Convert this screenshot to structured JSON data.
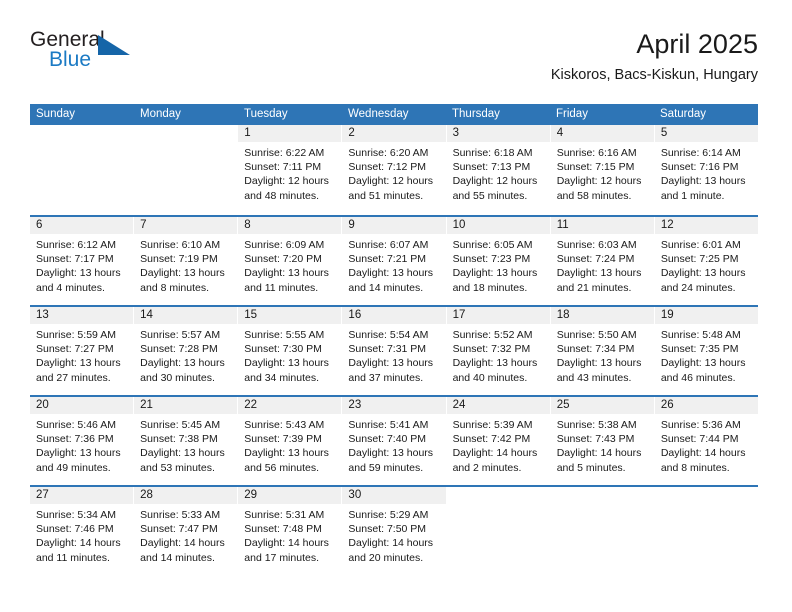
{
  "brand": {
    "logo_general": "General",
    "logo_blue": "Blue",
    "accent_color": "#1b7ac4",
    "header_color": "#2e75b6"
  },
  "header": {
    "title": "April 2025",
    "subtitle": "Kiskoros, Bacs-Kiskun, Hungary"
  },
  "weekdays": [
    "Sunday",
    "Monday",
    "Tuesday",
    "Wednesday",
    "Thursday",
    "Friday",
    "Saturday"
  ],
  "weeks": [
    [
      {
        "day": "",
        "sunrise": "",
        "sunset": "",
        "daylight1": "",
        "daylight2": ""
      },
      {
        "day": "",
        "sunrise": "",
        "sunset": "",
        "daylight1": "",
        "daylight2": ""
      },
      {
        "day": "1",
        "sunrise": "Sunrise: 6:22 AM",
        "sunset": "Sunset: 7:11 PM",
        "daylight1": "Daylight: 12 hours",
        "daylight2": "and 48 minutes."
      },
      {
        "day": "2",
        "sunrise": "Sunrise: 6:20 AM",
        "sunset": "Sunset: 7:12 PM",
        "daylight1": "Daylight: 12 hours",
        "daylight2": "and 51 minutes."
      },
      {
        "day": "3",
        "sunrise": "Sunrise: 6:18 AM",
        "sunset": "Sunset: 7:13 PM",
        "daylight1": "Daylight: 12 hours",
        "daylight2": "and 55 minutes."
      },
      {
        "day": "4",
        "sunrise": "Sunrise: 6:16 AM",
        "sunset": "Sunset: 7:15 PM",
        "daylight1": "Daylight: 12 hours",
        "daylight2": "and 58 minutes."
      },
      {
        "day": "5",
        "sunrise": "Sunrise: 6:14 AM",
        "sunset": "Sunset: 7:16 PM",
        "daylight1": "Daylight: 13 hours",
        "daylight2": "and 1 minute."
      }
    ],
    [
      {
        "day": "6",
        "sunrise": "Sunrise: 6:12 AM",
        "sunset": "Sunset: 7:17 PM",
        "daylight1": "Daylight: 13 hours",
        "daylight2": "and 4 minutes."
      },
      {
        "day": "7",
        "sunrise": "Sunrise: 6:10 AM",
        "sunset": "Sunset: 7:19 PM",
        "daylight1": "Daylight: 13 hours",
        "daylight2": "and 8 minutes."
      },
      {
        "day": "8",
        "sunrise": "Sunrise: 6:09 AM",
        "sunset": "Sunset: 7:20 PM",
        "daylight1": "Daylight: 13 hours",
        "daylight2": "and 11 minutes."
      },
      {
        "day": "9",
        "sunrise": "Sunrise: 6:07 AM",
        "sunset": "Sunset: 7:21 PM",
        "daylight1": "Daylight: 13 hours",
        "daylight2": "and 14 minutes."
      },
      {
        "day": "10",
        "sunrise": "Sunrise: 6:05 AM",
        "sunset": "Sunset: 7:23 PM",
        "daylight1": "Daylight: 13 hours",
        "daylight2": "and 18 minutes."
      },
      {
        "day": "11",
        "sunrise": "Sunrise: 6:03 AM",
        "sunset": "Sunset: 7:24 PM",
        "daylight1": "Daylight: 13 hours",
        "daylight2": "and 21 minutes."
      },
      {
        "day": "12",
        "sunrise": "Sunrise: 6:01 AM",
        "sunset": "Sunset: 7:25 PM",
        "daylight1": "Daylight: 13 hours",
        "daylight2": "and 24 minutes."
      }
    ],
    [
      {
        "day": "13",
        "sunrise": "Sunrise: 5:59 AM",
        "sunset": "Sunset: 7:27 PM",
        "daylight1": "Daylight: 13 hours",
        "daylight2": "and 27 minutes."
      },
      {
        "day": "14",
        "sunrise": "Sunrise: 5:57 AM",
        "sunset": "Sunset: 7:28 PM",
        "daylight1": "Daylight: 13 hours",
        "daylight2": "and 30 minutes."
      },
      {
        "day": "15",
        "sunrise": "Sunrise: 5:55 AM",
        "sunset": "Sunset: 7:30 PM",
        "daylight1": "Daylight: 13 hours",
        "daylight2": "and 34 minutes."
      },
      {
        "day": "16",
        "sunrise": "Sunrise: 5:54 AM",
        "sunset": "Sunset: 7:31 PM",
        "daylight1": "Daylight: 13 hours",
        "daylight2": "and 37 minutes."
      },
      {
        "day": "17",
        "sunrise": "Sunrise: 5:52 AM",
        "sunset": "Sunset: 7:32 PM",
        "daylight1": "Daylight: 13 hours",
        "daylight2": "and 40 minutes."
      },
      {
        "day": "18",
        "sunrise": "Sunrise: 5:50 AM",
        "sunset": "Sunset: 7:34 PM",
        "daylight1": "Daylight: 13 hours",
        "daylight2": "and 43 minutes."
      },
      {
        "day": "19",
        "sunrise": "Sunrise: 5:48 AM",
        "sunset": "Sunset: 7:35 PM",
        "daylight1": "Daylight: 13 hours",
        "daylight2": "and 46 minutes."
      }
    ],
    [
      {
        "day": "20",
        "sunrise": "Sunrise: 5:46 AM",
        "sunset": "Sunset: 7:36 PM",
        "daylight1": "Daylight: 13 hours",
        "daylight2": "and 49 minutes."
      },
      {
        "day": "21",
        "sunrise": "Sunrise: 5:45 AM",
        "sunset": "Sunset: 7:38 PM",
        "daylight1": "Daylight: 13 hours",
        "daylight2": "and 53 minutes."
      },
      {
        "day": "22",
        "sunrise": "Sunrise: 5:43 AM",
        "sunset": "Sunset: 7:39 PM",
        "daylight1": "Daylight: 13 hours",
        "daylight2": "and 56 minutes."
      },
      {
        "day": "23",
        "sunrise": "Sunrise: 5:41 AM",
        "sunset": "Sunset: 7:40 PM",
        "daylight1": "Daylight: 13 hours",
        "daylight2": "and 59 minutes."
      },
      {
        "day": "24",
        "sunrise": "Sunrise: 5:39 AM",
        "sunset": "Sunset: 7:42 PM",
        "daylight1": "Daylight: 14 hours",
        "daylight2": "and 2 minutes."
      },
      {
        "day": "25",
        "sunrise": "Sunrise: 5:38 AM",
        "sunset": "Sunset: 7:43 PM",
        "daylight1": "Daylight: 14 hours",
        "daylight2": "and 5 minutes."
      },
      {
        "day": "26",
        "sunrise": "Sunrise: 5:36 AM",
        "sunset": "Sunset: 7:44 PM",
        "daylight1": "Daylight: 14 hours",
        "daylight2": "and 8 minutes."
      }
    ],
    [
      {
        "day": "27",
        "sunrise": "Sunrise: 5:34 AM",
        "sunset": "Sunset: 7:46 PM",
        "daylight1": "Daylight: 14 hours",
        "daylight2": "and 11 minutes."
      },
      {
        "day": "28",
        "sunrise": "Sunrise: 5:33 AM",
        "sunset": "Sunset: 7:47 PM",
        "daylight1": "Daylight: 14 hours",
        "daylight2": "and 14 minutes."
      },
      {
        "day": "29",
        "sunrise": "Sunrise: 5:31 AM",
        "sunset": "Sunset: 7:48 PM",
        "daylight1": "Daylight: 14 hours",
        "daylight2": "and 17 minutes."
      },
      {
        "day": "30",
        "sunrise": "Sunrise: 5:29 AM",
        "sunset": "Sunset: 7:50 PM",
        "daylight1": "Daylight: 14 hours",
        "daylight2": "and 20 minutes."
      },
      {
        "day": "",
        "sunrise": "",
        "sunset": "",
        "daylight1": "",
        "daylight2": ""
      },
      {
        "day": "",
        "sunrise": "",
        "sunset": "",
        "daylight1": "",
        "daylight2": ""
      },
      {
        "day": "",
        "sunrise": "",
        "sunset": "",
        "daylight1": "",
        "daylight2": ""
      }
    ]
  ]
}
